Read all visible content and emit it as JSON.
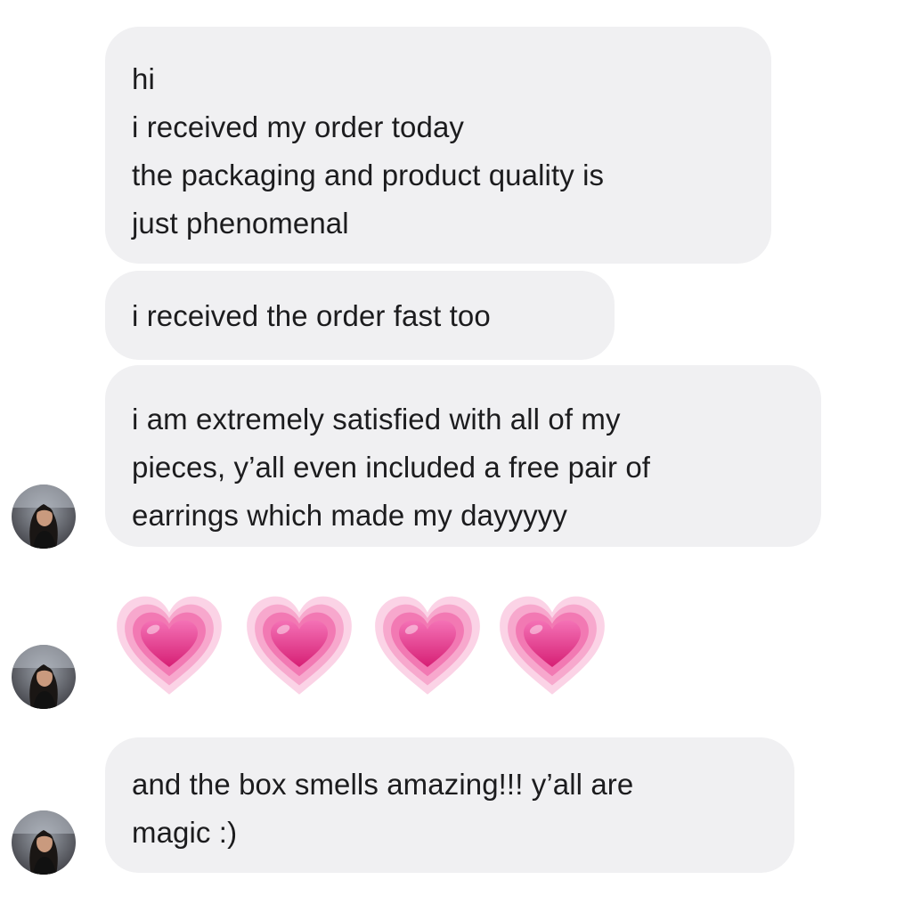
{
  "messages": [
    {
      "id": "msg-1",
      "lines": [
        "hi",
        "i received my order today",
        "the packaging and product quality is",
        "just phenomenal"
      ]
    },
    {
      "id": "msg-2",
      "lines": [
        "i received the order fast too"
      ]
    },
    {
      "id": "msg-3",
      "lines": [
        "i am extremely satisfied with all of my",
        "pieces, y’all even included a free pair of",
        "earrings which made my dayyyyy"
      ]
    },
    {
      "id": "msg-4",
      "emoji": [
        "growing-heart",
        "growing-heart",
        "growing-heart",
        "growing-heart"
      ]
    },
    {
      "id": "msg-5",
      "lines": [
        "and the box smells amazing!!! y’all are",
        "magic :)"
      ]
    }
  ],
  "colors": {
    "bubble": "#f0f0f2",
    "text": "#1c1c1e",
    "heart": "#e8408f"
  }
}
